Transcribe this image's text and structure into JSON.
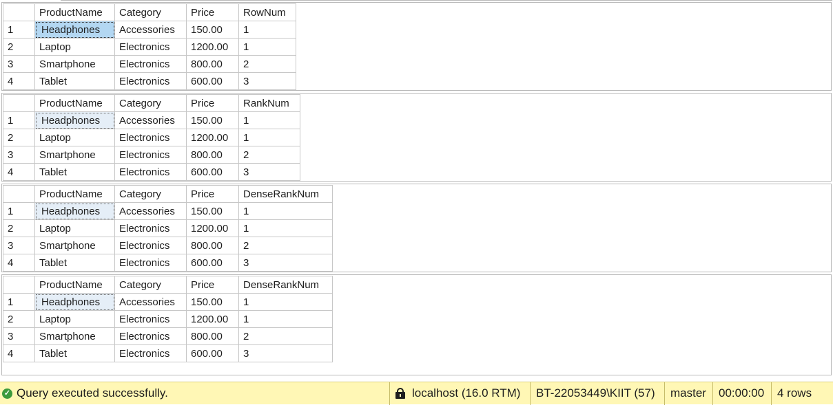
{
  "result_sets": [
    {
      "columns": [
        "ProductName",
        "Category",
        "Price",
        "RowNum"
      ],
      "rows": [
        {
          "num": "1",
          "cells": [
            "Headphones",
            "Accessories",
            "150.00",
            "1"
          ]
        },
        {
          "num": "2",
          "cells": [
            "Laptop",
            "Electronics",
            "1200.00",
            "1"
          ]
        },
        {
          "num": "3",
          "cells": [
            "Smartphone",
            "Electronics",
            "800.00",
            "2"
          ]
        },
        {
          "num": "4",
          "cells": [
            "Tablet",
            "Electronics",
            "600.00",
            "3"
          ]
        }
      ]
    },
    {
      "columns": [
        "ProductName",
        "Category",
        "Price",
        "RankNum"
      ],
      "rows": [
        {
          "num": "1",
          "cells": [
            "Headphones",
            "Accessories",
            "150.00",
            "1"
          ]
        },
        {
          "num": "2",
          "cells": [
            "Laptop",
            "Electronics",
            "1200.00",
            "1"
          ]
        },
        {
          "num": "3",
          "cells": [
            "Smartphone",
            "Electronics",
            "800.00",
            "2"
          ]
        },
        {
          "num": "4",
          "cells": [
            "Tablet",
            "Electronics",
            "600.00",
            "3"
          ]
        }
      ]
    },
    {
      "columns": [
        "ProductName",
        "Category",
        "Price",
        "DenseRankNum"
      ],
      "rows": [
        {
          "num": "1",
          "cells": [
            "Headphones",
            "Accessories",
            "150.00",
            "1"
          ]
        },
        {
          "num": "2",
          "cells": [
            "Laptop",
            "Electronics",
            "1200.00",
            "1"
          ]
        },
        {
          "num": "3",
          "cells": [
            "Smartphone",
            "Electronics",
            "800.00",
            "2"
          ]
        },
        {
          "num": "4",
          "cells": [
            "Tablet",
            "Electronics",
            "600.00",
            "3"
          ]
        }
      ]
    },
    {
      "columns": [
        "ProductName",
        "Category",
        "Price",
        "DenseRankNum"
      ],
      "rows": [
        {
          "num": "1",
          "cells": [
            "Headphones",
            "Accessories",
            "150.00",
            "1"
          ]
        },
        {
          "num": "2",
          "cells": [
            "Laptop",
            "Electronics",
            "1200.00",
            "1"
          ]
        },
        {
          "num": "3",
          "cells": [
            "Smartphone",
            "Electronics",
            "800.00",
            "2"
          ]
        },
        {
          "num": "4",
          "cells": [
            "Tablet",
            "Electronics",
            "600.00",
            "3"
          ]
        }
      ]
    }
  ],
  "status": {
    "message": "Query executed successfully.",
    "server": "localhost (16.0 RTM)",
    "user": "BT-22053449\\KIIT (57)",
    "database": "master",
    "elapsed": "00:00:00",
    "rows": "4 rows",
    "success_icon": "check-circle-icon",
    "lock_icon": "lock-icon"
  },
  "colors": {
    "status_bar_bg": "#fff7b5",
    "selected_cell_bg": "#b3d7f2",
    "inactive_selected_cell_bg": "#e5eef7",
    "success_green": "#3c9a3c"
  }
}
